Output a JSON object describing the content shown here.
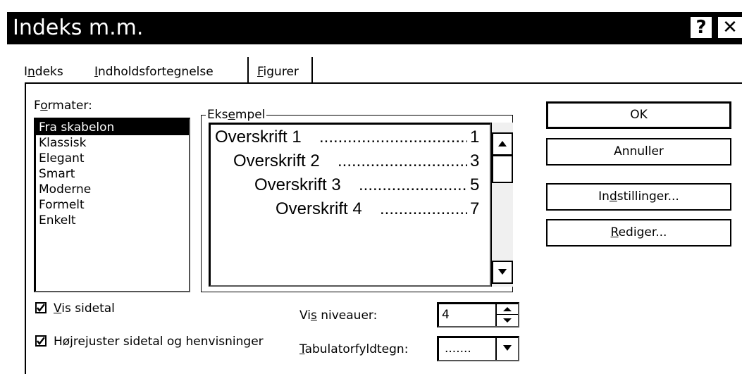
{
  "dialog": {
    "title": "Indeks m.m.",
    "help_glyph": "?",
    "close_glyph": "✕"
  },
  "tabs": [
    {
      "pre": "I",
      "mn": "n",
      "post": "deks"
    },
    {
      "pre": "",
      "mn": "I",
      "post": "ndholdsfortegnelse"
    },
    {
      "pre": "",
      "mn": "F",
      "post": "igurer"
    }
  ],
  "formats": {
    "label_pre": "F",
    "label_mn": "o",
    "label_post": "rmater:",
    "items": [
      "Fra skabelon",
      "Klassisk",
      "Elegant",
      "Smart",
      "Moderne",
      "Formelt",
      "Enkelt"
    ],
    "selected_index": 0
  },
  "example": {
    "label_pre": "Eks",
    "label_mn": "e",
    "label_post": "mpel",
    "lines": [
      {
        "text": "Overskrift 1",
        "page": "1"
      },
      {
        "text": "Overskrift 2",
        "page": "3"
      },
      {
        "text": "Overskrift 3",
        "page": "5"
      },
      {
        "text": "Overskrift 4",
        "page": "7"
      }
    ],
    "dot_fill": "................................................"
  },
  "buttons": {
    "ok": "OK",
    "cancel": "Annuller",
    "settings_pre": "In",
    "settings_mn": "d",
    "settings_post": "stillinger...",
    "edit_pre": "",
    "edit_mn": "R",
    "edit_post": "ediger..."
  },
  "options": {
    "show_page_numbers": {
      "pre": "",
      "mn": "V",
      "post": "is sidetal",
      "checked": true
    },
    "right_align": {
      "pre": "Højre",
      "mn": "j",
      "post": "uster sidetal og henvisninger",
      "checked": true
    },
    "levels_label": {
      "pre": "Vi",
      "mn": "s",
      "post": " niveauer:"
    },
    "levels_value": "4",
    "tab_leader_label": {
      "pre": "",
      "mn": "T",
      "post": "abulatorfyldtegn:"
    },
    "tab_leader_value": "......."
  }
}
